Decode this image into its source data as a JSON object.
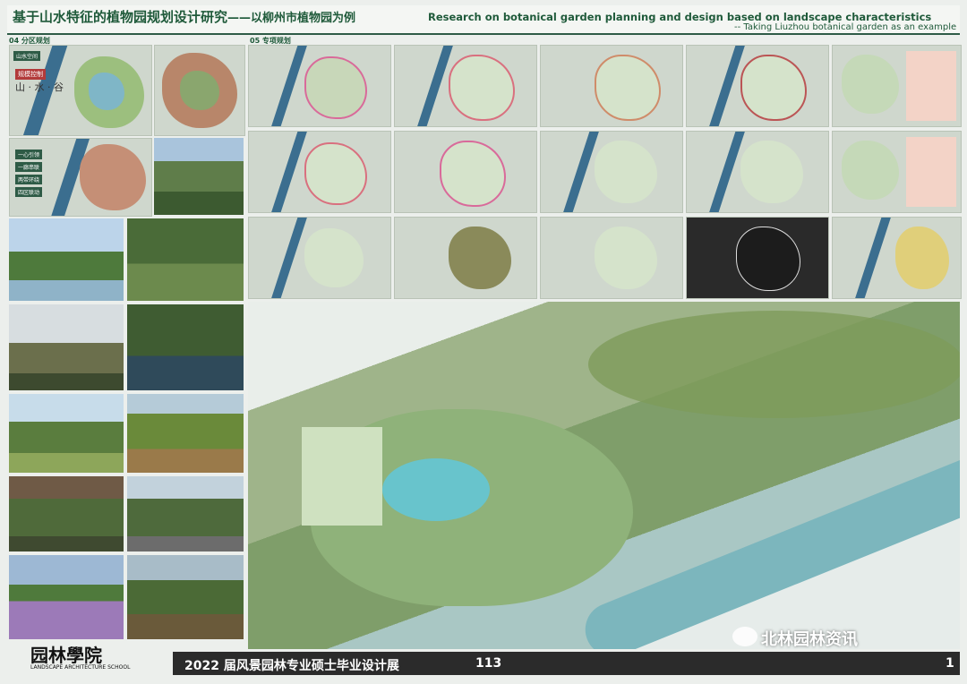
{
  "header": {
    "title_cn": "基于山水特征的植物园规划设计研究",
    "title_cn_sub": "——以柳州市植物园为例",
    "title_en": "Research on botanical garden planning and design based on landscape characteristics",
    "title_en_sub": "-- Taking Liuzhou botanical garden as an example"
  },
  "sections": {
    "s4": "04 分区规划",
    "s5": "05 专项规划"
  },
  "zoning": {
    "chars": "山 · 水 · 谷",
    "legend": [
      "一心引领",
      "一廊串联",
      "两带环绕",
      "四区联动"
    ]
  },
  "footer": {
    "logo_cn": "园林學院",
    "logo_en": "LANDSCAPE ARCHITECTURE SCHOOL",
    "exhibition": "2022 届风景园林专业硕士毕业设计展",
    "exhibit_no": "113",
    "page": "1"
  },
  "watermark": "北林园林资讯",
  "colors": {
    "accent": "#2e5b46",
    "river": "#3b6e8f",
    "footer": "#2b2b2b"
  }
}
